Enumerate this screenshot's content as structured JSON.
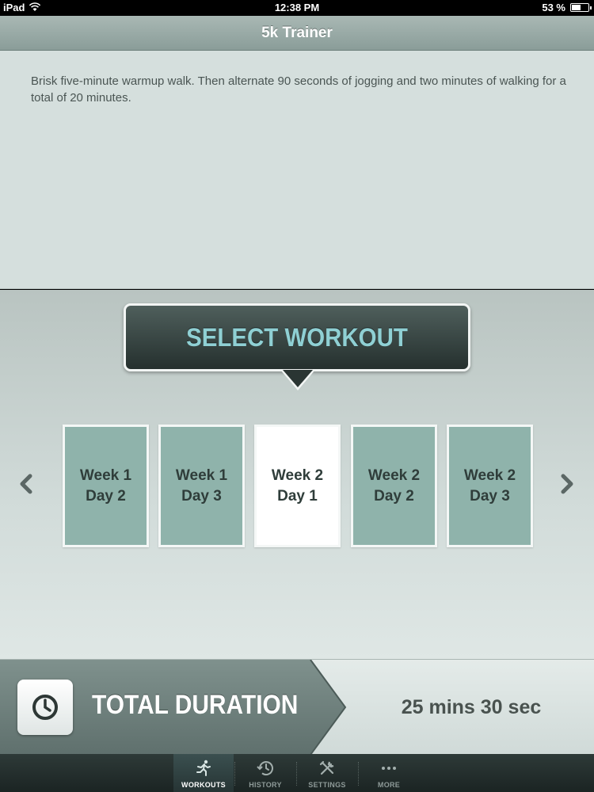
{
  "status_bar": {
    "carrier": "iPad",
    "time": "12:38 PM",
    "battery": "53 %",
    "battery_level": 0.53
  },
  "nav": {
    "title": "5k Trainer"
  },
  "description": "Brisk five-minute warmup walk. Then alternate 90 seconds of jogging and two minutes of walking for a total of 20 minutes.",
  "select_workout": {
    "label": "SELECT WORKOUT",
    "workouts": [
      {
        "week": "Week 1",
        "day": "Day 2",
        "selected": false
      },
      {
        "week": "Week 1",
        "day": "Day 3",
        "selected": false
      },
      {
        "week": "Week 2",
        "day": "Day 1",
        "selected": true
      },
      {
        "week": "Week 2",
        "day": "Day 2",
        "selected": false
      },
      {
        "week": "Week 2",
        "day": "Day 3",
        "selected": false
      }
    ],
    "prev_icon": "chevron-left-icon",
    "next_icon": "chevron-right-icon"
  },
  "duration": {
    "label": "TOTAL DURATION",
    "value": "25 mins 30 sec",
    "icon": "clock-icon"
  },
  "tabs": [
    {
      "label": "WORKOUTS",
      "icon": "runner-icon",
      "active": true
    },
    {
      "label": "HISTORY",
      "icon": "history-icon",
      "active": false
    },
    {
      "label": "SETTINGS",
      "icon": "tools-icon",
      "active": false
    },
    {
      "label": "MORE",
      "icon": "more-icon",
      "active": false
    }
  ],
  "colors": {
    "accent_teal": "#8fd0d4",
    "card_fill": "#8fb3ab",
    "selected_card": "#ffffff",
    "tab_bar": "#1b2423"
  }
}
